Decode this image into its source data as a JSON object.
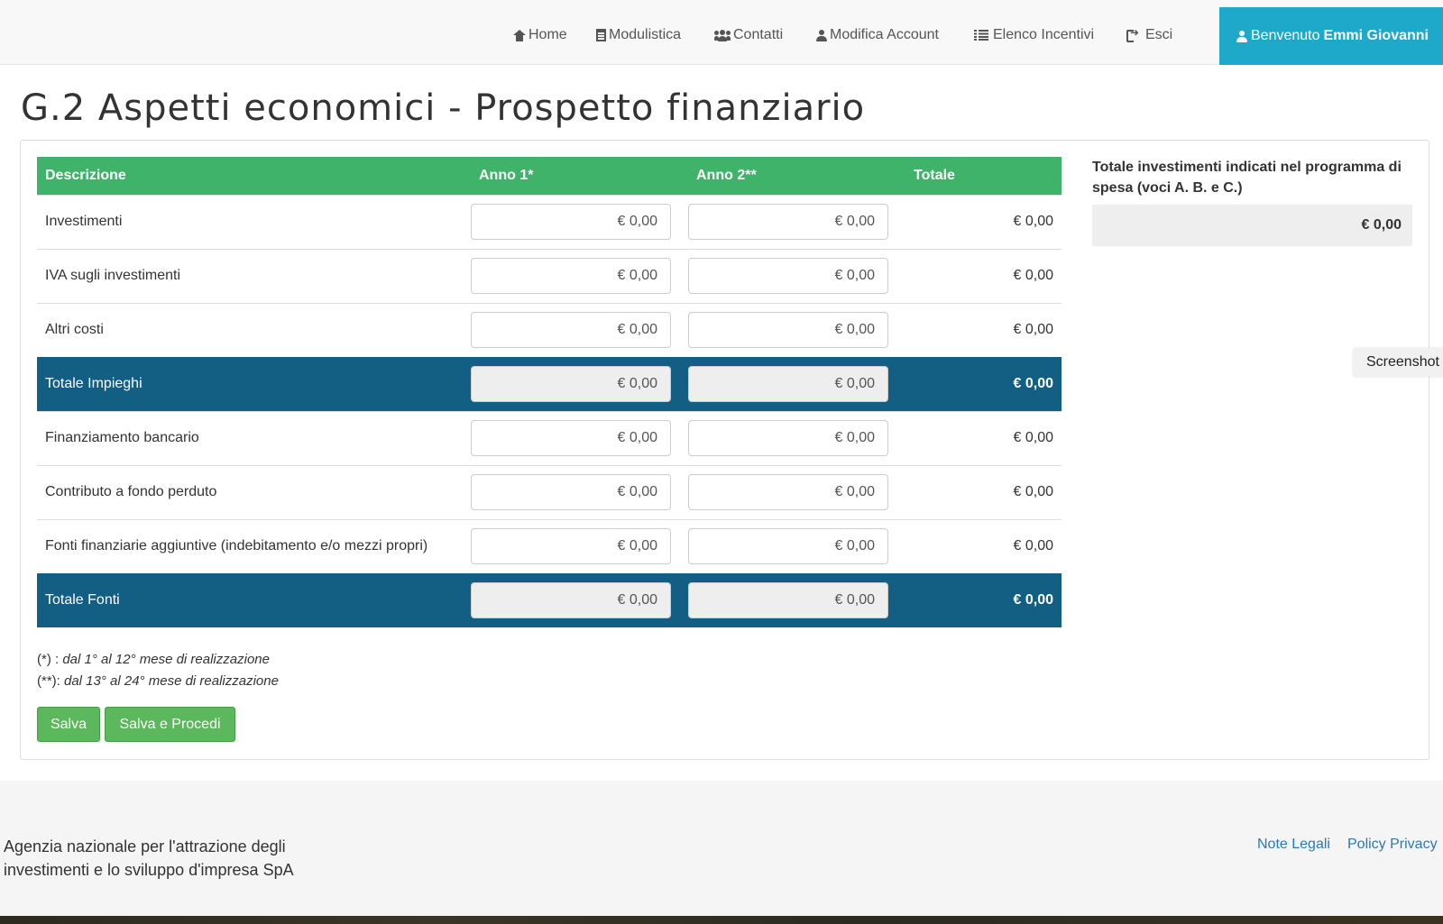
{
  "nav": {
    "items": [
      {
        "label": "Home",
        "icon": "home-icon"
      },
      {
        "label": "Modulistica",
        "icon": "document-icon"
      },
      {
        "label": "Contatti",
        "icon": "users-icon"
      },
      {
        "label": "Modifica Account",
        "icon": "user-icon"
      },
      {
        "label": "Elenco Incentivi",
        "icon": "list-icon"
      },
      {
        "label": "Esci",
        "icon": "sign-out-icon"
      }
    ],
    "welcome_prefix": "Benvenuto",
    "welcome_name": "Emmi Giovanni",
    "welcome_color": "#1ea8c9"
  },
  "page": {
    "title": "G.2 Aspetti economici - Prospetto finanziario"
  },
  "table": {
    "headers": [
      "Descrizione",
      "Anno 1*",
      "Anno 2**",
      "Totale"
    ],
    "header_color": "#3fb36a",
    "total_row_color": "#135e83",
    "rows": [
      {
        "label": "Investimenti",
        "anno1": "€ 0,00",
        "anno2": "€ 0,00",
        "totale": "€ 0,00",
        "total": false
      },
      {
        "label": "IVA sugli investimenti",
        "anno1": "€ 0,00",
        "anno2": "€ 0,00",
        "totale": "€ 0,00",
        "total": false
      },
      {
        "label": "Altri costi",
        "anno1": "€ 0,00",
        "anno2": "€ 0,00",
        "totale": "€ 0,00",
        "total": false
      },
      {
        "label": "Totale Impieghi",
        "anno1": "€ 0,00",
        "anno2": "€ 0,00",
        "totale": "€ 0,00",
        "total": true
      },
      {
        "label": "Finanziamento bancario",
        "anno1": "€ 0,00",
        "anno2": "€ 0,00",
        "totale": "€ 0,00",
        "total": false
      },
      {
        "label": "Contributo a fondo perduto",
        "anno1": "€ 0,00",
        "anno2": "€ 0,00",
        "totale": "€ 0,00",
        "total": false
      },
      {
        "label": "Fonti finanziarie aggiuntive (indebitamento e/o mezzi propri)",
        "anno1": "€ 0,00",
        "anno2": "€ 0,00",
        "totale": "€ 0,00",
        "total": false
      },
      {
        "label": "Totale Fonti",
        "anno1": "€ 0,00",
        "anno2": "€ 0,00",
        "totale": "€ 0,00",
        "total": true
      }
    ]
  },
  "side": {
    "title": "Totale investimenti indicati nel programma di spesa (voci A. B. e C.)",
    "value": "€ 0,00"
  },
  "screenshot_tab": "Screenshot",
  "notes": {
    "n1_key": "(*) : ",
    "n1_text": "dal 1° al 12° mese di realizzazione",
    "n2_key": "(**): ",
    "n2_text": "dal 13° al 24° mese di realizzazione"
  },
  "buttons": {
    "save": "Salva",
    "save_proceed": "Salva e Procedi",
    "color": "#5cb85c"
  },
  "footer": {
    "org_line1": "Agenzia nazionale per l'attrazione degli",
    "org_line2": "investimenti e lo sviluppo d'impresa SpA",
    "link_legal": "Note Legali",
    "link_privacy": "Policy Privacy"
  }
}
